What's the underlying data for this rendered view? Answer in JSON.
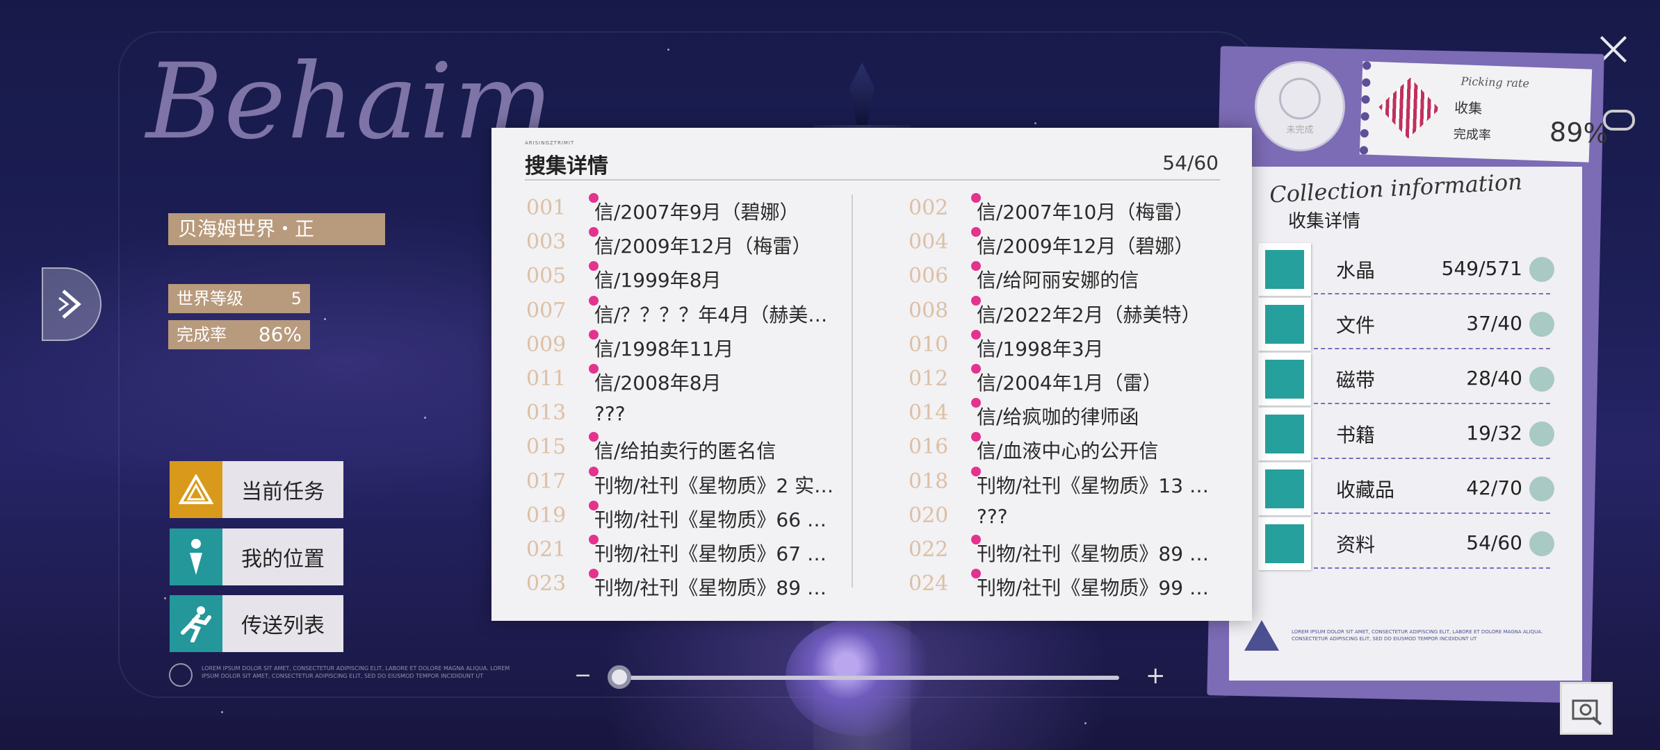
{
  "world": {
    "script_title": "Behaim",
    "name": "贝海姆世界・正",
    "level_label": "世界等级",
    "level_value": "5",
    "rate_label": "完成率",
    "rate_value": "86%"
  },
  "menu": {
    "task": "当前任务",
    "location": "我的位置",
    "teleport": "传送列表"
  },
  "footer_lorem": "LOREM IPSUM DOLOR SIT AMET, CONSECTETUR ADIPISCING ELIT, LABORE ET DOLORE MAGNA ALIQUA. LOREM IPSUM DOLOR SIT AMET, CONSECTETUR ADIPISCING ELIT, SED DO EIUSMOD TEMPOR INCIDIDUNT UT",
  "zoom": {
    "minus": "−",
    "plus": "+",
    "level": 0.02
  },
  "detail": {
    "tag": "ARISINGZTRIMIT",
    "title": "搜集详情",
    "count": "54/60",
    "items": [
      {
        "num": "001",
        "name": "信/2007年9月（碧娜）",
        "marked": true
      },
      {
        "num": "002",
        "name": "信/2007年10月（梅雷）",
        "marked": true
      },
      {
        "num": "003",
        "name": "信/2009年12月（梅雷）",
        "marked": true
      },
      {
        "num": "004",
        "name": "信/2009年12月（碧娜）",
        "marked": true
      },
      {
        "num": "005",
        "name": "信/1999年8月",
        "marked": true
      },
      {
        "num": "006",
        "name": "信/给阿丽安娜的信",
        "marked": true
      },
      {
        "num": "007",
        "name": "信/？？？？年4月（赫美…",
        "marked": true
      },
      {
        "num": "008",
        "name": "信/2022年2月（赫美特）",
        "marked": true
      },
      {
        "num": "009",
        "name": "信/1998年11月",
        "marked": true
      },
      {
        "num": "010",
        "name": "信/1998年3月",
        "marked": true
      },
      {
        "num": "011",
        "name": "信/2008年8月",
        "marked": true
      },
      {
        "num": "012",
        "name": "信/2004年1月（雷）",
        "marked": true
      },
      {
        "num": "013",
        "name": "???",
        "marked": false
      },
      {
        "num": "014",
        "name": "信/给疯咖的律师函",
        "marked": true
      },
      {
        "num": "015",
        "name": "信/给拍卖行的匿名信",
        "marked": true
      },
      {
        "num": "016",
        "name": "信/血液中心的公开信",
        "marked": true
      },
      {
        "num": "017",
        "name": "刊物/社刊《星物质》2 实…",
        "marked": true
      },
      {
        "num": "018",
        "name": "刊物/社刊《星物质》13 …",
        "marked": true
      },
      {
        "num": "019",
        "name": "刊物/社刊《星物质》66 …",
        "marked": true
      },
      {
        "num": "020",
        "name": "???",
        "marked": false
      },
      {
        "num": "021",
        "name": "刊物/社刊《星物质》67 …",
        "marked": true
      },
      {
        "num": "022",
        "name": "刊物/社刊《星物质》89 …",
        "marked": true
      },
      {
        "num": "023",
        "name": "刊物/社刊《星物质》89 …",
        "marked": true
      },
      {
        "num": "024",
        "name": "刊物/社刊《星物质》99 …",
        "marked": true
      }
    ]
  },
  "panel": {
    "seal_text": "未完成",
    "rate_script": "Picking rate",
    "rate_label_1": "收集",
    "rate_label_2": "完成率",
    "rate_value": "89%",
    "collection_script": "Collection information",
    "collection_title": "收集详情",
    "categories": [
      {
        "name": "水晶",
        "count": "549/571",
        "icon": "crystal-icon"
      },
      {
        "name": "文件",
        "count": "37/40",
        "icon": "folder-icon"
      },
      {
        "name": "磁带",
        "count": "28/40",
        "icon": "cassette-icon"
      },
      {
        "name": "书籍",
        "count": "19/32",
        "icon": "book-icon"
      },
      {
        "name": "收藏品",
        "count": "42/70",
        "icon": "gramophone-icon"
      },
      {
        "name": "资料",
        "count": "54/60",
        "icon": "documents-icon"
      }
    ],
    "footer_text": "LOREM IPSUM DOLOR SIT AMET, CONSECTETUR ADIPISCING ELIT, LABORE ET DOLORE MAGNA ALIQUA. CONSECTETUR ADIPISCING ELIT, SED DO EIUSMOD TEMPOR INCIDIDUNT UT"
  },
  "colors": {
    "accent_pink": "#e4328f",
    "teal": "#23979a",
    "gold": "#d99a1b",
    "chip": "#b89a7d",
    "panel_purple": "#7c6bb5"
  }
}
